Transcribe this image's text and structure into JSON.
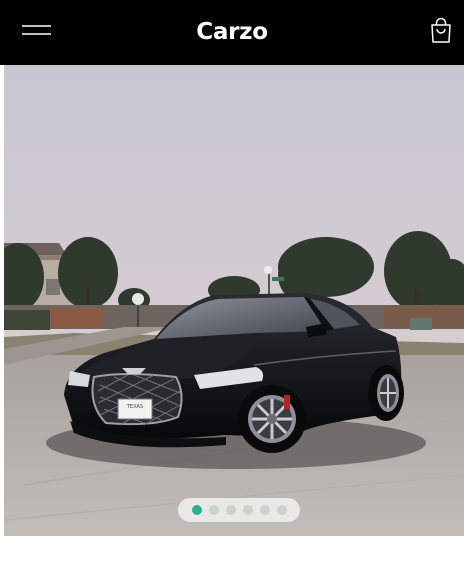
{
  "header": {
    "brand": "Carzo",
    "menu_icon": "hamburger-menu-icon",
    "cart_icon": "shopping-bag-icon",
    "background": "#000000"
  },
  "carousel": {
    "slide_count": 6,
    "active_index": 0,
    "active_color": "#26b28a",
    "inactive_color": "#cfcfcf",
    "plate_text": "TEXAS"
  }
}
